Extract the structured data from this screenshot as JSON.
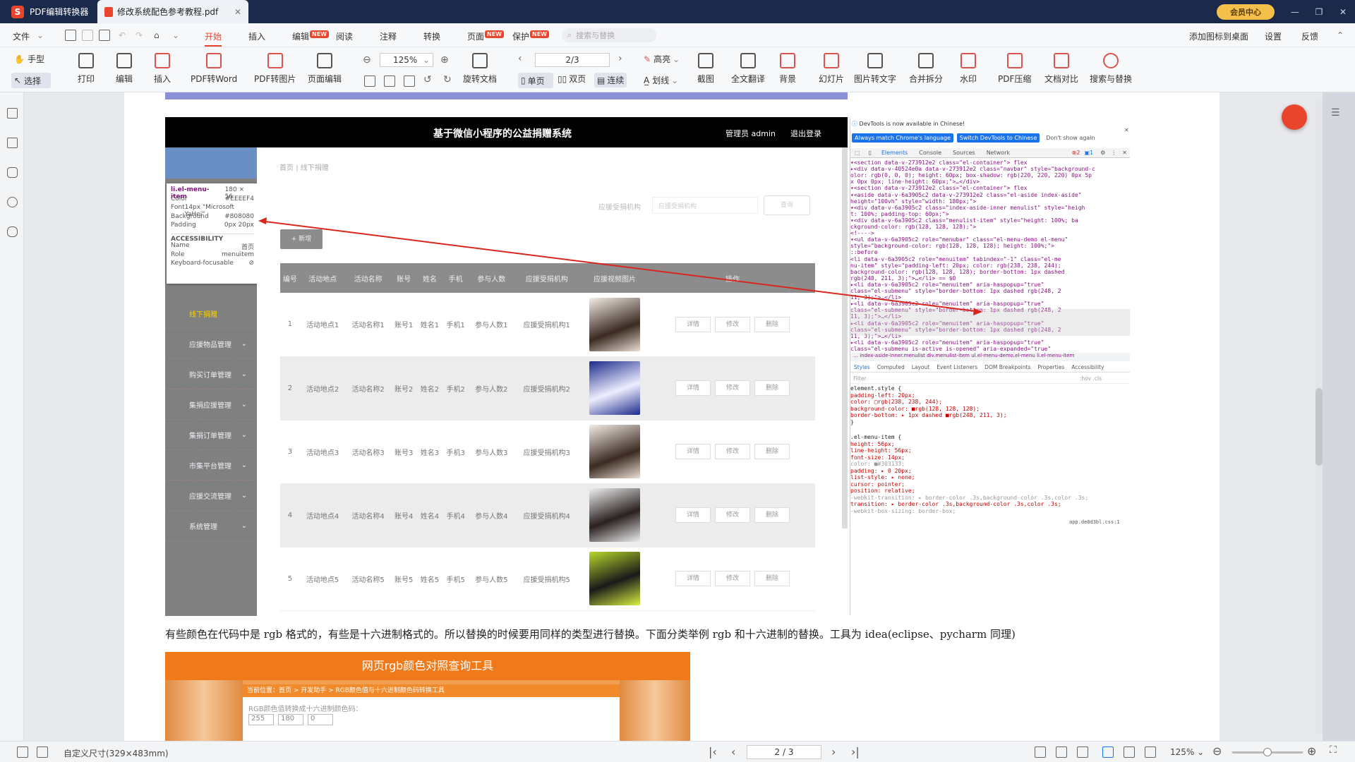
{
  "titlebar": {
    "app_tab": "PDF编辑转换器",
    "doc_tab": "修改系统配色参考教程.pdf",
    "vip": "会员中心"
  },
  "menubar": {
    "file": "文件",
    "start": "开始",
    "insert": "插入",
    "edit": "编辑",
    "read": "阅读",
    "annotate": "注释",
    "convert": "转换",
    "page": "页面",
    "protect": "保护",
    "search_placeholder": "搜索与替换",
    "add_icon": "添加图标到桌面",
    "settings": "设置",
    "feedback": "反馈",
    "new_badge": "NEW"
  },
  "toolbar": {
    "hand": "手型",
    "select": "选择",
    "print": "打印",
    "edit": "编辑",
    "insert": "插入",
    "pdf2word": "PDF转Word",
    "pdf2img": "PDF转图片",
    "page_edit": "页面编辑",
    "zoom": "125%",
    "page_num": "2/3",
    "rotate": "旋转文档",
    "single": "单页",
    "double": "双页",
    "continuous": "连续",
    "highlight": "高亮",
    "strike": "划线",
    "crop": "截图",
    "translate": "全文翻译",
    "background": "背景",
    "slides": "幻灯片",
    "ocr": "图片转文字",
    "merge": "合并拆分",
    "watermark": "水印",
    "compress": "PDF压缩",
    "compare": "文档对比",
    "search_replace": "搜索与替换"
  },
  "web": {
    "title": "基于微信小程序的公益捐赠系统",
    "admin": "管理员 admin",
    "logout": "退出登录",
    "breadcrumb_home": "首页",
    "breadcrumb_sep": "|",
    "breadcrumb_cur": "线下捐赠",
    "search_label": "应援受捐机构",
    "search_placeholder": "应援受捐机构",
    "search_btn": "查询",
    "add_btn": "+ 新增"
  },
  "tooltip": {
    "selector": "li.el-menu-item",
    "size": "180 × 56",
    "color_label": "Color",
    "color_val": "#EEEEF4",
    "font_label": "Font",
    "font_val": "14px \"Microsoft YaHei\"",
    "bg_label": "Background",
    "bg_val": "#808080",
    "pad_label": "Padding",
    "pad_val": "0px 20px",
    "access": "ACCESSIBILITY",
    "name_label": "Name",
    "name_val": "首页",
    "role_label": "Role",
    "role_val": "menuitem",
    "kf_label": "Keyboard-focusable"
  },
  "sidebar": {
    "items": [
      "线下捐赠",
      "应援物品管理",
      "购买订单管理",
      "集捐应援管理",
      "集捐订单管理",
      "市集平台管理",
      "应援交流管理",
      "系统管理"
    ]
  },
  "table": {
    "headers": [
      "编号",
      "活动地点",
      "活动名称",
      "账号",
      "姓名",
      "手机",
      "参与人数",
      "应援受捐机构",
      "应援视频图片",
      "操作"
    ],
    "rows": [
      [
        "1",
        "活动地点1",
        "活动名称1",
        "账号1",
        "姓名1",
        "手机1",
        "参与人数1",
        "应援受捐机构1"
      ],
      [
        "2",
        "活动地点2",
        "活动名称2",
        "账号2",
        "姓名2",
        "手机2",
        "参与人数2",
        "应援受捐机构2"
      ],
      [
        "3",
        "活动地点3",
        "活动名称3",
        "账号3",
        "姓名3",
        "手机3",
        "参与人数3",
        "应援受捐机构3"
      ],
      [
        "4",
        "活动地点4",
        "活动名称4",
        "账号4",
        "姓名4",
        "手机4",
        "参与人数4",
        "应援受捐机构4"
      ],
      [
        "5",
        "活动地点5",
        "活动名称5",
        "账号5",
        "姓名5",
        "手机5",
        "参与人数5",
        "应援受捐机构5"
      ]
    ],
    "ops": [
      "详情",
      "修改",
      "删除"
    ]
  },
  "devtools": {
    "notice": "DevTools is now available in Chinese!",
    "btn1": "Always match Chrome's language",
    "btn2": "Switch DevTools to Chinese",
    "btn3": "Don't show again",
    "tabs": [
      "Elements",
      "Console",
      "Sources",
      "Network"
    ],
    "errors": "2",
    "msgs": "1",
    "lines": [
      "▾<section data-v-273912e2 class=\"el-container\"> flex",
      "  ▸<div data-v-40524e0a data-v-273912e2 class=\"navbar\" style=\"background-c",
      "    olor: rgb(0, 0, 0); height: 60px; box-shadow: rgb(220, 220, 220) 0px 5p",
      "    x 0px 0px; line-height: 60px;\">…</div>",
      "  ▾<section data-v-273912e2 class=\"el-container\"> flex",
      "    ▾<aside data-v-6a3905c2 data-v-273912e2 class=\"el-aside index-aside\"",
      "      height=\"100vh\" style=\"width: 180px;\">",
      "      ▾<div data-v-6a3905c2 class=\"index-aside-inner menulist\" style=\"heigh",
      "        t: 100%; padding-top: 60px;\">",
      "        ▾<div data-v-6a3905c2 class=\"menulist-item\" style=\"height: 100%; ba",
      "          ckground-color: rgb(128, 128, 128);\">",
      "          <!---->",
      "          ▾<ul data-v-6a3905c2 role=\"menubar\" class=\"el-menu-demo el-menu\"",
      "            style=\"background-color: rgb(128, 128, 128); height: 100%;\">",
      "            ::before",
      "            <li data-v-6a3905c2 role=\"menuitem\" tabindex=\"-1\" class=\"el-me",
      "            nu-item\" style=\"padding-left: 20px; color: rgb(238, 238, 244);",
      "            background-color: rgb(128, 128, 128); border-bottom: 1px dashed",
      "            rgb(248, 211, 3);\">…</li> == $0",
      "            ▸<li data-v-6a3905c2 role=\"menuitem\" aria-haspopup=\"true\"",
      "            class=\"el-submenu\" style=\"border-bottom: 1px dashed rgb(248, 2",
      "            11, 3);\">…</li>",
      "            ▸<li data-v-6a3905c2 role=\"menuitem\" aria-haspopup=\"true\"",
      "            class=\"el-submenu\" style=\"border-bottom: 1px dashed rgb(248, 2",
      "            11, 3);\">…</li>",
      "            ▸<li data-v-6a3905c2 role=\"menuitem\" aria-haspopup=\"true\"",
      "            class=\"el-submenu\" style=\"border-bottom: 1px dashed rgb(248, 2",
      "            11, 3);\">…</li>",
      "            ▸<li data-v-6a3905c2 role=\"menuitem\" aria-haspopup=\"true\"",
      "            class=\"el-submenu is-active is-opened\" aria-expanded=\"true\""
    ],
    "crumbs": "… index-aside-inner.menulist   div.menulist-item   ul.el-menu-demo.el-menu   li.el-menu-item",
    "style_tabs": [
      "Styles",
      "Computed",
      "Layout",
      "Event Listeners",
      "DOM Breakpoints",
      "Properties",
      "Accessibility"
    ],
    "filter": "Filter",
    "hov": ":hov .cls",
    "css_lines": [
      "element.style {",
      "  padding-left: 20px;",
      "  color: ▢rgb(238, 238, 244);",
      "  background-color: ■rgb(128, 128, 128);",
      "  border-bottom: ▸ 1px dashed ■rgb(248, 211, 3);",
      "}",
      ".el-menu-item {",
      "  height: 56px;",
      "  line-height: 56px;",
      "  font-size: 14px;",
      "  color: ■#303133;",
      "  padding: ▸ 0 20px;",
      "  list-style: ▸ none;",
      "  cursor: pointer;",
      "  position: relative;",
      "  -webkit-transition: ▸ border-color .3s,background-color .3s,color .3s;",
      "  transition: ▸ border-color .3s,background-color .3s,color .3s;",
      "  -webkit-box-sizing: border-box;"
    ],
    "css_source": "app.de8d3bl.css:1"
  },
  "paragraph": "有些颜色在代码中是 rgb 格式的，有些是十六进制格式的。所以替换的时候要用同样的类型进行替换。下面分类举例 rgb 和十六进制的替换。工具为 idea(eclipse、pycharm 同理)",
  "rgbtool": {
    "title": "网页rgb颜色对照查询工具",
    "crumbs": "当前位置：首页 > 开发助手 > RGB颜色值与十六进制颜色码转换工具",
    "label": "RGB颜色值转换成十六进制颜色码：",
    "r": "255",
    "g": "180",
    "b": "0"
  },
  "status": {
    "page_size": "自定义尺寸(329×483mm)",
    "page": "2 / 3",
    "zoom": "125%"
  }
}
